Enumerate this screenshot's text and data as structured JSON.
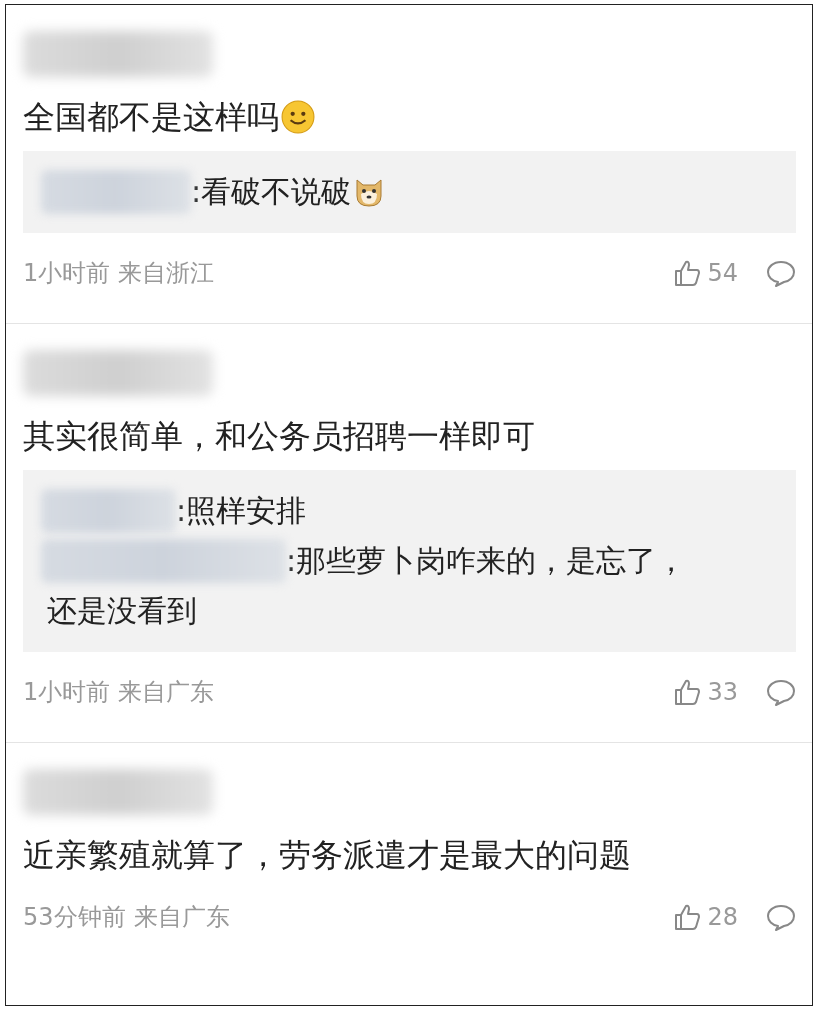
{
  "comments": [
    {
      "text": "全国都不是这样吗",
      "emoji": {
        "kind": "smiley"
      },
      "replies": [
        {
          "lines": [
            ":看破不说破"
          ],
          "emoji": {
            "kind": "doge"
          }
        }
      ],
      "time": "1小时前",
      "location": "来自浙江",
      "likes": "54"
    },
    {
      "text": "其实很简单，和公务员招聘一样即可",
      "replies": [
        {
          "lines": [
            ":照样安排"
          ]
        },
        {
          "lines": [
            ":那些萝卜岗咋来的，是忘了，",
            "还是没看到"
          ]
        }
      ],
      "time": "1小时前",
      "location": "来自广东",
      "likes": "33"
    },
    {
      "text": "近亲繁殖就算了，劳务派遣才是最大的问题",
      "time": "53分钟前",
      "location": "来自广东",
      "likes": "28"
    }
  ]
}
